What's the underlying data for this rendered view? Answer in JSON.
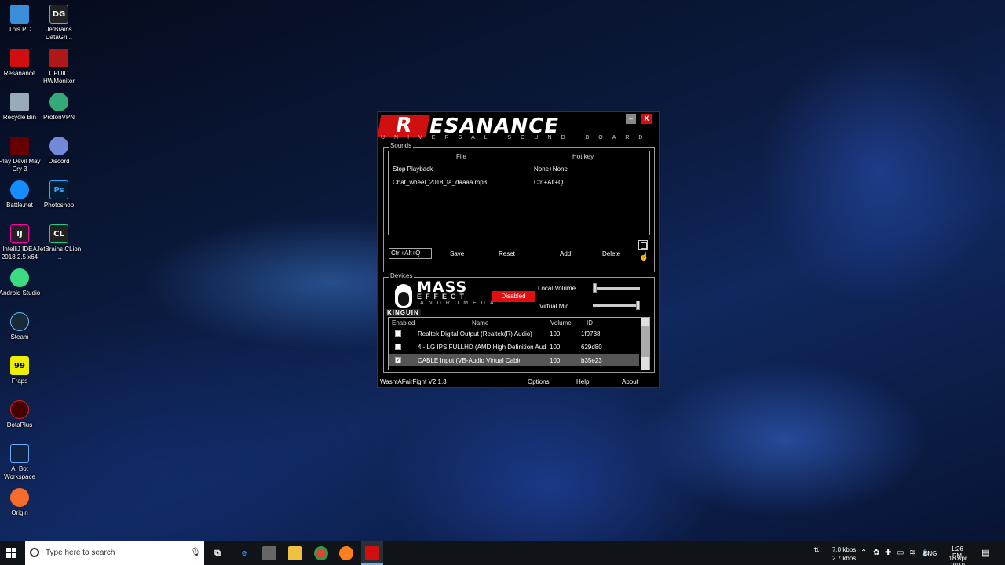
{
  "desktop": {
    "icons": [
      {
        "label": "This PC"
      },
      {
        "label": "JetBrains DataGri..."
      },
      {
        "label": "Resanance"
      },
      {
        "label": "CPUID HWMonitor"
      },
      {
        "label": "Recycle Bin"
      },
      {
        "label": "ProtonVPN"
      },
      {
        "label": "Play Devil May Cry 3"
      },
      {
        "label": "Discord"
      },
      {
        "label": "Battle.net"
      },
      {
        "label": "Photoshop"
      },
      {
        "label": "IntelliJ IDEA 2018.2.5 x64"
      },
      {
        "label": "JetBrains CLion ..."
      },
      {
        "label": "Android Studio"
      },
      {
        "label": "Steam"
      },
      {
        "label": "Fraps"
      },
      {
        "label": "DotaPlus"
      },
      {
        "label": "AI Bot Workspace"
      },
      {
        "label": "Origin"
      }
    ],
    "icon_glyphs": {
      "datagrip": "DG",
      "photoshop": "Ps",
      "clion": "CL",
      "intellij": "IJ",
      "fraps": "99"
    }
  },
  "app": {
    "logo_letter": "R",
    "logo_text": "ESANANCE",
    "logo_sub": "UNIVERSAL SOUND BOARD",
    "min_glyph": "–",
    "close_glyph": "X",
    "sounds": {
      "group_label": "Sounds",
      "columns": {
        "file": "File",
        "hotkey": "Hot key"
      },
      "rows": [
        {
          "file": "Stop Playback",
          "hotkey": "None+None"
        },
        {
          "file": "Chat_wheel_2018_ta_daaaa.mp3",
          "hotkey": "Ctrl+Alt+Q"
        }
      ],
      "hotkey_value": "Ctrl+Alt+Q",
      "buttons": {
        "save": "Save",
        "reset": "Reset",
        "add": "Add",
        "delete": "Delete"
      }
    },
    "devices": {
      "group_label": "Devices",
      "logo": {
        "mass": "MASS",
        "effect": "EFFECT",
        "andromeda": "ANDROMEDA",
        "kinguin": "KINGUIN"
      },
      "disabled_label": "Disabled",
      "local_volume_label": "Local Volume",
      "virtual_mic_label": "Virtual Mic",
      "local_volume_level": 0.0,
      "virtual_mic_level": 1.0,
      "columns": {
        "enabled": "Enabled",
        "name": "Name",
        "volume": "Volume",
        "id": "ID"
      },
      "rows": [
        {
          "enabled": false,
          "name": "Realtek Digital Output (Realtek(R) Audio)",
          "volume": "100",
          "id": "1f9738"
        },
        {
          "enabled": false,
          "name": "4 - LG IPS FULLHD (AMD High Definition Aud",
          "volume": "100",
          "id": "629d80"
        },
        {
          "enabled": true,
          "name": "CABLE Input (VB-Audio Virtual Cable)",
          "volume": "100",
          "id": "b35e23"
        }
      ]
    },
    "footer": {
      "version": "WasntAFairFight V2.1.3",
      "options": "Options",
      "help": "Help",
      "about": "About"
    },
    "colors": {
      "brand_red": "#d01010",
      "disabled_red": "#e01010"
    }
  },
  "taskbar": {
    "search_placeholder": "Type here to search",
    "net_up": "7.0 kbps",
    "net_down": "2.7 kbps",
    "language": "ENG",
    "time": "1:26 PM",
    "date": "18 Apr 2019"
  }
}
